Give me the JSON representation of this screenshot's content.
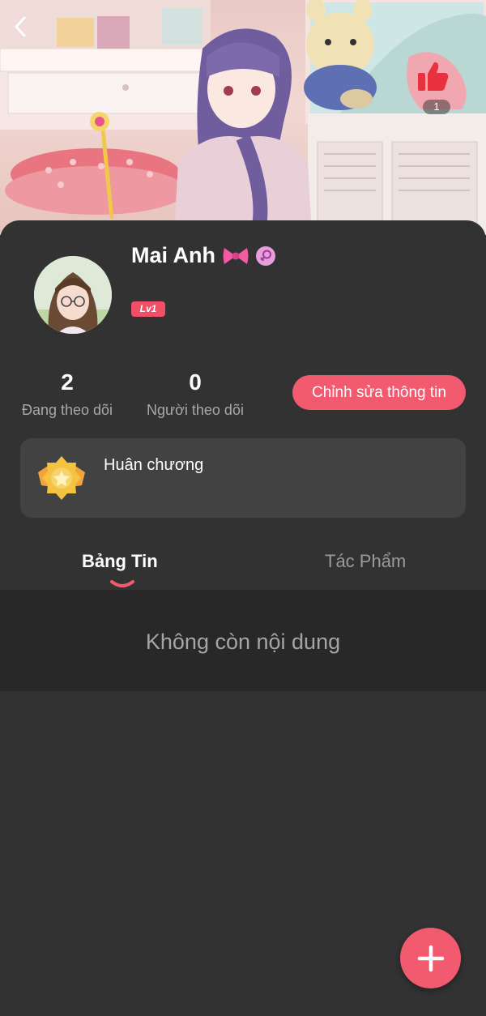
{
  "header": {
    "back_icon": "chevron-left-icon",
    "like_icon": "thumbs-up-icon",
    "like_count": "1"
  },
  "profile": {
    "name": "Mai Anh",
    "name_emoji": "bow-icon",
    "gender_icon": "female-icon",
    "level": "Lv1",
    "following_count": "2",
    "following_label": "Đang theo dõi",
    "followers_count": "0",
    "followers_label": "Người theo dõi",
    "edit_button": "Chỉnh sửa thông tin"
  },
  "medal": {
    "title": "Huân chương",
    "icon": "medal-icon"
  },
  "tabs": [
    {
      "label": "Bảng Tin",
      "active": true
    },
    {
      "label": "Tác Phẩm",
      "active": false
    }
  ],
  "feed": {
    "empty_text": "Không còn nội dung"
  },
  "fab": {
    "icon": "plus-icon"
  },
  "colors": {
    "accent": "#f25a6f",
    "background": "#323232",
    "card": "#424242",
    "muted_text": "#a8a8a8"
  }
}
